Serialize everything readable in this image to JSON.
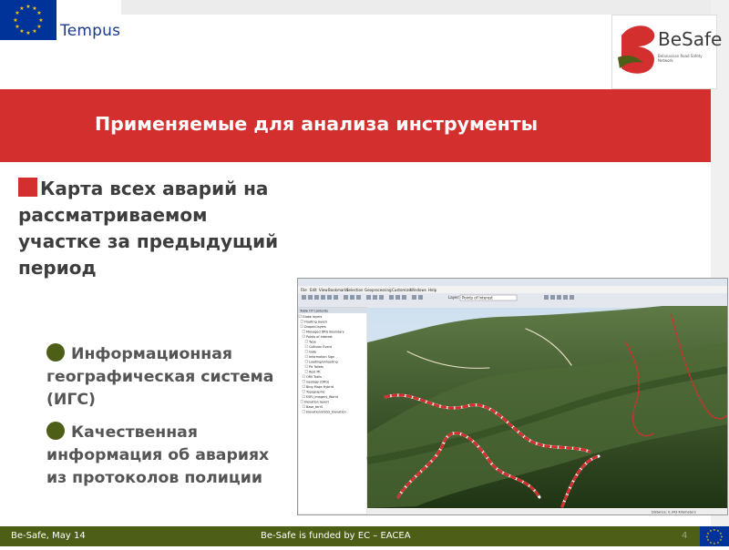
{
  "header": {
    "partner_logo_text": "Tempus",
    "project_logo_text": "BeSafe",
    "project_logo_subtitle": "Belarussian Road Safety Network"
  },
  "banner": {
    "title": "Применяемые для анализа инструменты"
  },
  "content": {
    "bullet_main": "Карта всех аварий на рассматриваемом участке за предыдущий период",
    "sub_bullets": [
      "Информационная географическая система (ИГС)",
      "Качественная информация об авариях из протоколов полиции"
    ]
  },
  "gis_window": {
    "menu": [
      "File",
      "Edit",
      "View",
      "Bookmarks",
      "Selection",
      "Geoprocessing",
      "Customize",
      "Windows",
      "Help"
    ],
    "layer_label": "Layer:",
    "layer_value": "Points of Interest",
    "toc_title": "Table Of Contents",
    "toc_items": [
      "Globe layers",
      "Floating layers",
      "Draped layers",
      "Managed DRG Boundary",
      "Points of Interest",
      "Type",
      "Collision Event",
      "Gate",
      "Information Sign",
      "Loading/Unloading",
      "Pit Toilets",
      "Rest Pit",
      "ORV Trails",
      "Geology (DRG)",
      "Bing Maps Hybrid",
      "Topographic",
      "ESRI_Imagery_World",
      "Elevation layers",
      "Base_terrS",
      "Elevation/USGS_Elevation"
    ],
    "status_text": "Distance: 0.343 Kilometers"
  },
  "footer": {
    "left": "Be-Safe, May 14",
    "center": "Be-Safe is funded by EC – EACEA",
    "page": "4"
  },
  "colors": {
    "banner_red": "#d32f2f",
    "footer_green": "#4d5e17",
    "bullet_dot": "#4d5e17",
    "eu_blue": "#003399"
  }
}
